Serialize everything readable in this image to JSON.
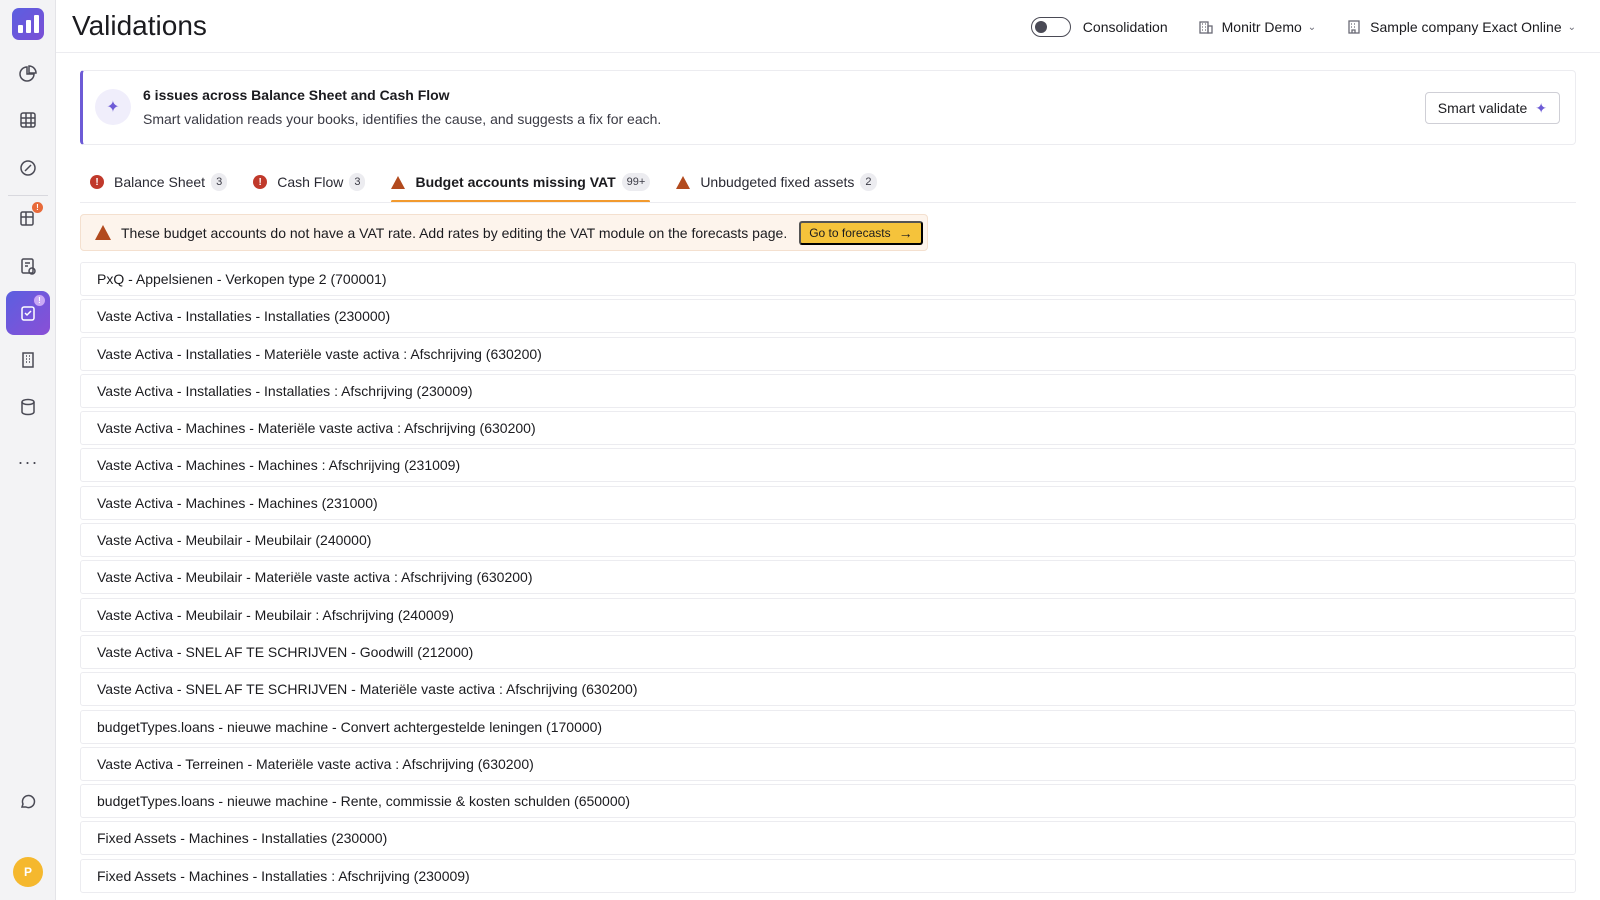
{
  "app": {
    "avatar_initial": "P"
  },
  "header": {
    "title": "Validations",
    "consolidation_label": "Consolidation",
    "org_selector": "Monitr Demo",
    "company_selector": "Sample company Exact Online"
  },
  "summary": {
    "title": "6 issues across Balance Sheet and Cash Flow",
    "subtitle": "Smart validation reads your books, identifies the cause, and suggests a fix for each.",
    "button_label": "Smart validate"
  },
  "tabs": [
    {
      "label": "Balance Sheet",
      "count": "3",
      "icon": "error-icon"
    },
    {
      "label": "Cash Flow",
      "count": "3",
      "icon": "error-icon"
    },
    {
      "label": "Budget accounts missing VAT",
      "count": "99+",
      "icon": "warning-icon",
      "active": true
    },
    {
      "label": "Unbudgeted fixed assets",
      "count": "2",
      "icon": "warning-icon"
    }
  ],
  "banner": {
    "text": "These budget accounts do not have a VAT rate. Add rates by editing the VAT module on the forecasts page.",
    "button_label": "Go to forecasts"
  },
  "accounts": [
    "PxQ - Appelsienen - Verkopen type 2 (700001)",
    "Vaste Activa - Installaties - Installaties (230000)",
    "Vaste Activa - Installaties - Materiële vaste activa : Afschrijving (630200)",
    "Vaste Activa - Installaties - Installaties : Afschrijving (230009)",
    "Vaste Activa - Machines - Materiële vaste activa : Afschrijving (630200)",
    "Vaste Activa - Machines - Machines : Afschrijving (231009)",
    "Vaste Activa - Machines - Machines (231000)",
    "Vaste Activa - Meubilair - Meubilair (240000)",
    "Vaste Activa - Meubilair - Materiële vaste activa : Afschrijving (630200)",
    "Vaste Activa - Meubilair - Meubilair : Afschrijving (240009)",
    "Vaste Activa - SNEL AF TE SCHRIJVEN - Goodwill (212000)",
    "Vaste Activa - SNEL AF TE SCHRIJVEN - Materiële vaste activa : Afschrijving (630200)",
    "budgetTypes.loans - nieuwe machine - Convert achtergestelde leningen (170000)",
    "Vaste Activa - Terreinen - Materiële vaste activa : Afschrijving (630200)",
    "budgetTypes.loans - nieuwe machine - Rente, commissie & kosten schulden (650000)",
    "Fixed Assets - Machines - Installaties (230000)",
    "Fixed Assets - Machines - Installaties : Afschrijving (230009)"
  ],
  "colors": {
    "accent": "#6d5bd6",
    "tab_underline": "#f29a2e",
    "error": "#c0392b",
    "warning": "#b24a1e",
    "cta": "#f5c33b"
  }
}
